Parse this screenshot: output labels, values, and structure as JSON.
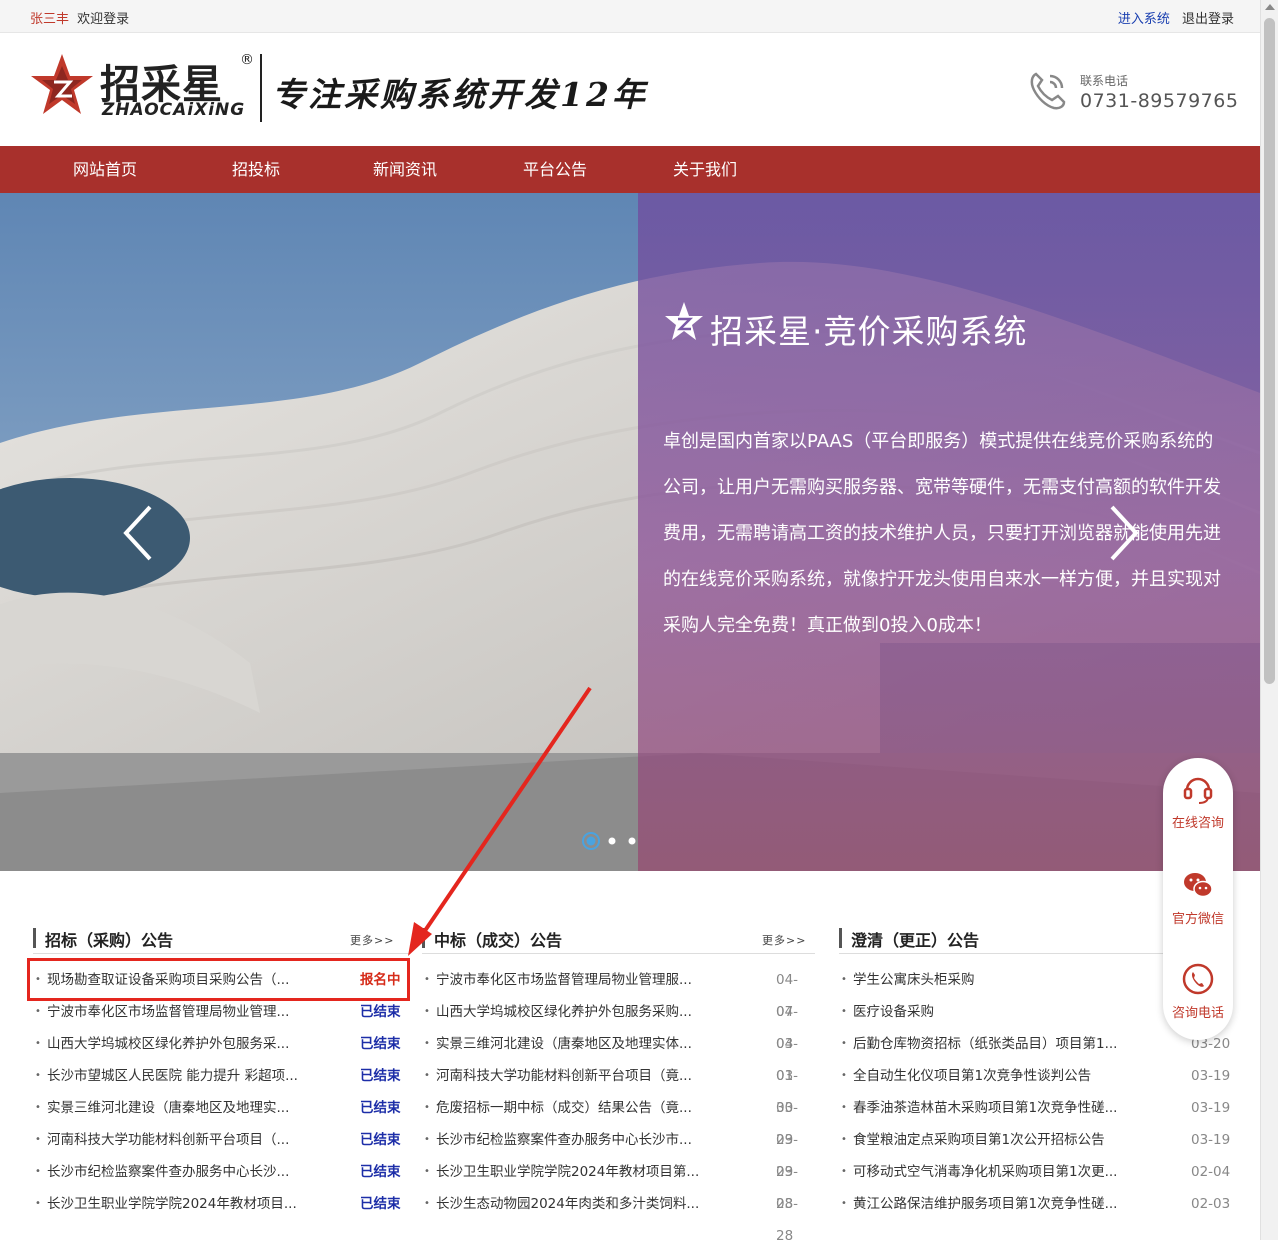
{
  "topbar": {
    "user": "张三丰",
    "welcome": "欢迎登录",
    "enter_system": "进入系统",
    "logout": "退出登录"
  },
  "header": {
    "logo_cn": "招采星",
    "logo_reg": "®",
    "logo_en": "ZHAOCAiXiNG",
    "slogan": "专注采购系统开发12年",
    "phone_label": "联系电话",
    "phone_number": "0731-89579765"
  },
  "nav": {
    "items": [
      {
        "label": "网站首页"
      },
      {
        "label": "招投标"
      },
      {
        "label": "新闻资讯"
      },
      {
        "label": "平台公告"
      },
      {
        "label": "关于我们"
      }
    ]
  },
  "banner": {
    "title": "招采星·竞价采购系统",
    "text": "卓创是国内首家以PAAS（平台即服务）模式提供在线竞价采购系统的公司，让用户无需购买服务器、宽带等硬件，无需支付高额的软件开发费用，无需聘请高工资的技术维护人员，只要打开浏览器就能使用先进的在线竞价采购系统，就像拧开龙头使用自来水一样方便，并且实现对采购人完全免费！真正做到0投入0成本！",
    "active_slide": 1,
    "slide_count": 3
  },
  "side_widget": {
    "online": "在线咨询",
    "wechat": "官方微信",
    "phone": "咨询电话"
  },
  "columns": {
    "tender": {
      "title": "招标（采购）公告",
      "more": "更多>>",
      "items": [
        {
          "text": "现场勘查取证设备采购项目采购公告（...",
          "status": "报名中",
          "state": "open"
        },
        {
          "text": "宁波市奉化区市场监督管理局物业管理...",
          "status": "已结束",
          "state": "done"
        },
        {
          "text": "山西大学坞城校区绿化养护外包服务采...",
          "status": "已结束",
          "state": "done"
        },
        {
          "text": "长沙市望城区人民医院 能力提升 彩超项...",
          "status": "已结束",
          "state": "done"
        },
        {
          "text": "实景三维河北建设（唐秦地区及地理实...",
          "status": "已结束",
          "state": "done"
        },
        {
          "text": "河南科技大学功能材料创新平台项目（...",
          "status": "已结束",
          "state": "done"
        },
        {
          "text": "长沙市纪检监察案件查办服务中心长沙...",
          "status": "已结束",
          "state": "done"
        },
        {
          "text": "长沙卫生职业学院学院2024年教材项目...",
          "status": "已结束",
          "state": "done"
        }
      ]
    },
    "award": {
      "title": "中标（成交）公告",
      "more": "更多>>",
      "items": [
        {
          "text": "宁波市奉化区市场监督管理局物业管理服...",
          "date": "04-07"
        },
        {
          "text": "山西大学坞城校区绿化养护外包服务采购...",
          "date": "04-03"
        },
        {
          "text": "实景三维河北建设（唐秦地区及地理实体...",
          "date": "04-01"
        },
        {
          "text": "河南科技大学功能材料创新平台项目（竟...",
          "date": "03-30"
        },
        {
          "text": "危废招标一期中标（成交）结果公告（竟...",
          "date": "03-29"
        },
        {
          "text": "长沙市纪检监察案件查办服务中心长沙市...",
          "date": "03-29"
        },
        {
          "text": "长沙卫生职业学院学院2024年教材项目第...",
          "date": "03-28"
        },
        {
          "text": "长沙生态动物园2024年肉类和多汁类饲料...",
          "date": "03-28"
        }
      ]
    },
    "clarify": {
      "title": "澄清（更正）公告",
      "items": [
        {
          "text": "学生公寓床头柜采购",
          "date": ""
        },
        {
          "text": "医疗设备采购",
          "date": ""
        },
        {
          "text": "后勤仓库物资招标（纸张类品目）项目第1...",
          "date": "03-20"
        },
        {
          "text": "全自动生化仪项目第1次竞争性谈判公告",
          "date": "03-19"
        },
        {
          "text": "春季油茶造林苗木采购项目第1次竞争性磋...",
          "date": "03-19"
        },
        {
          "text": "食堂粮油定点采购项目第1次公开招标公告",
          "date": "03-19"
        },
        {
          "text": "可移动式空气消毒净化机采购项目第1次更...",
          "date": "02-04"
        },
        {
          "text": "黄江公路保洁维护服务项目第1次竞争性磋...",
          "date": "02-03"
        }
      ]
    }
  },
  "colors": {
    "brand_red": "#a8302c",
    "status_open": "#d62c1a",
    "status_done": "#1d2ea8",
    "annotation": "#e4261e"
  }
}
